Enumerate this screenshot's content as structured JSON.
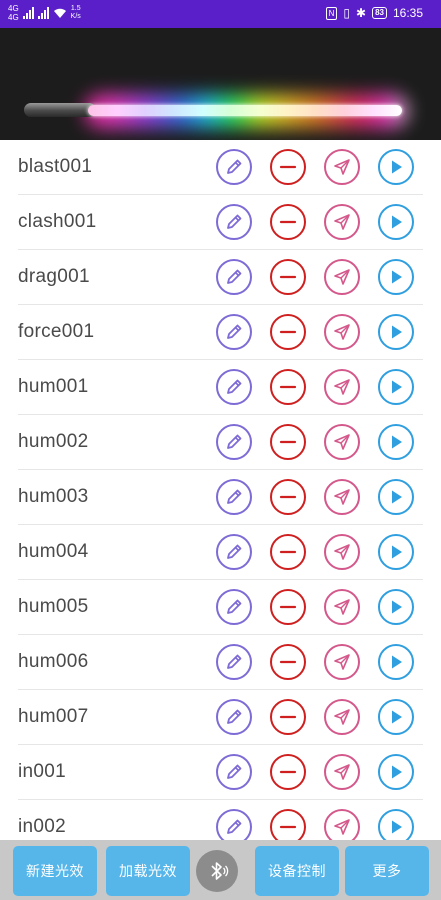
{
  "status_bar": {
    "left_label_1": "4G",
    "left_label_2": "4G",
    "speed_value": "1.5",
    "speed_unit": "K/s",
    "nfc": "N",
    "vibrate": "▯",
    "bluetooth": "✱",
    "battery": "83",
    "time": "16:35"
  },
  "items": [
    {
      "label": "blast001"
    },
    {
      "label": "clash001"
    },
    {
      "label": "drag001"
    },
    {
      "label": "force001"
    },
    {
      "label": "hum001"
    },
    {
      "label": "hum002"
    },
    {
      "label": "hum003"
    },
    {
      "label": "hum004"
    },
    {
      "label": "hum005"
    },
    {
      "label": "hum006"
    },
    {
      "label": "hum007"
    },
    {
      "label": "in001"
    },
    {
      "label": "in002"
    }
  ],
  "row_icons": [
    "edit-icon",
    "remove-icon",
    "send-icon",
    "play-icon"
  ],
  "colors": {
    "status_bar": "#5a1fc9",
    "edit": "#7e6bd6",
    "remove": "#cf1f1f",
    "send": "#d4588b",
    "play": "#2f9fe0",
    "bottom_button": "#56b6ea"
  },
  "bottom_bar": {
    "new_effect": "新建光效",
    "load_effect": "加载光效",
    "device_control": "设备控制",
    "more": "更多",
    "bluetooth_icon": "bluetooth-icon"
  }
}
